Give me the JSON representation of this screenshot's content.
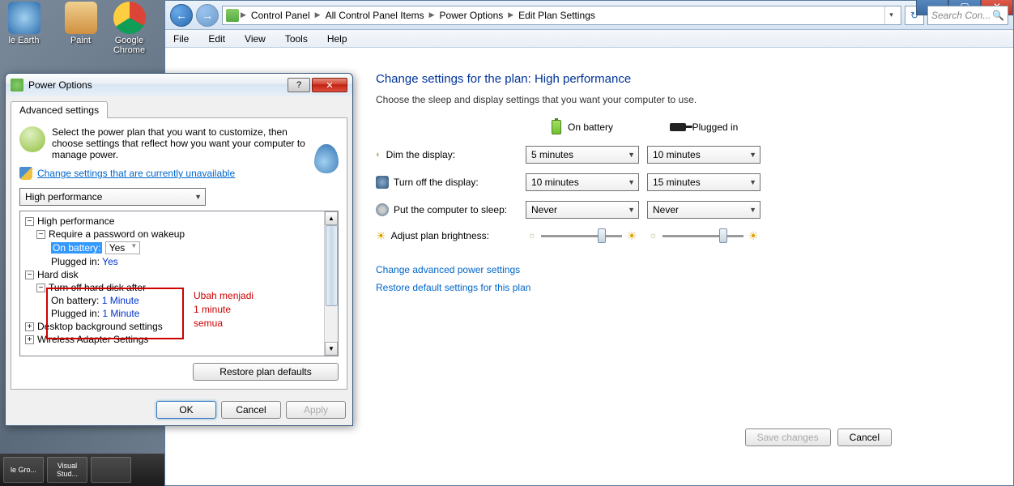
{
  "desktop": {
    "icons": [
      "le Earth",
      "Paint",
      "Google Chrome"
    ]
  },
  "explorer": {
    "titlebar": {
      "min": "—",
      "max": "▢",
      "close": "✕"
    },
    "nav": {
      "back": "←",
      "fwd": "→"
    },
    "breadcrumb": [
      "Control Panel",
      "All Control Panel Items",
      "Power Options",
      "Edit Plan Settings"
    ],
    "refresh": "↻",
    "search_placeholder": "Search Con...",
    "menu": [
      "File",
      "Edit",
      "View",
      "Tools",
      "Help"
    ],
    "page_title": "Change settings for the plan: High performance",
    "page_sub": "Choose the sleep and display settings that you want your computer to use.",
    "col_battery": "On battery",
    "col_plugged": "Plugged in",
    "rows": {
      "dim": {
        "label": "Dim the display:",
        "battery": "5 minutes",
        "plugged": "10 minutes"
      },
      "off": {
        "label": "Turn off the display:",
        "battery": "10 minutes",
        "plugged": "15 minutes"
      },
      "sleep": {
        "label": "Put the computer to sleep:",
        "battery": "Never",
        "plugged": "Never"
      },
      "bright": {
        "label": "Adjust plan brightness:"
      }
    },
    "link_adv": "Change advanced power settings",
    "link_restore": "Restore default settings for this plan",
    "btn_save": "Save changes",
    "btn_cancel": "Cancel"
  },
  "dialog": {
    "title": "Power Options",
    "help": "?",
    "close": "✕",
    "tab": "Advanced settings",
    "desc": "Select the power plan that you want to customize, then choose settings that reflect how you want your computer to manage power.",
    "link_unavail": "Change settings that are currently unavailable",
    "plan": "High performance",
    "tree": {
      "root": "High performance",
      "pw": "Require a password on wakeup",
      "pw_bat_k": "On battery:",
      "pw_bat_v": "Yes",
      "pw_plug_k": "Plugged in:",
      "pw_plug_v": "Yes",
      "hd": "Hard disk",
      "hd_off": "Turn off hard disk after",
      "hd_bat_k": "On battery:",
      "hd_bat_v": "1 Minute",
      "hd_plug_k": "Plugged in:",
      "hd_plug_v": "1 Minute",
      "dbg": "Desktop background settings",
      "wls": "Wireless Adapter Settings"
    },
    "note_l1": "Ubah menjadi",
    "note_l2": "1 minute",
    "note_l3": "semua",
    "btn_restore": "Restore plan defaults",
    "btn_ok": "OK",
    "btn_cancel": "Cancel",
    "btn_apply": "Apply"
  },
  "taskbar": {
    "i1": "le Gro...",
    "i2": "Visual Stud..."
  }
}
